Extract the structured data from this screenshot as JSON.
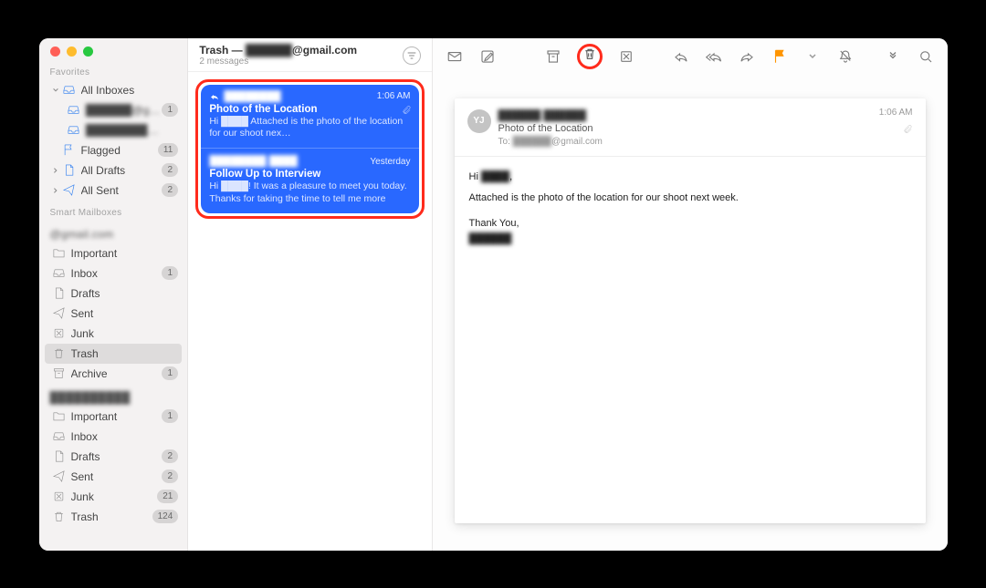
{
  "window": {
    "title_prefix": "Trash — ",
    "title_suffix": "@gmail.com",
    "subtitle": "2 messages"
  },
  "favorites_label": "Favorites",
  "favorites": [
    {
      "label": "All Inboxes",
      "count": null,
      "chevron": "down",
      "icon": "inbox"
    },
    {
      "label": "██████@g…",
      "count": "1",
      "indent": true,
      "icon": "inbox-sm",
      "blur": true
    },
    {
      "label": "████████…",
      "count": null,
      "indent": true,
      "icon": "inbox-sm",
      "blur": true
    },
    {
      "label": "Flagged",
      "count": "11",
      "icon": "flag"
    },
    {
      "label": "All Drafts",
      "count": "2",
      "chevron": "right",
      "icon": "doc"
    },
    {
      "label": "All Sent",
      "count": "2",
      "chevron": "right",
      "icon": "send"
    }
  ],
  "smart_label": "Smart Mailboxes",
  "account1": {
    "label": "@gmail.com",
    "items": [
      {
        "label": "Important",
        "icon": "folder"
      },
      {
        "label": "Inbox",
        "count": "1",
        "icon": "inbox-sm"
      },
      {
        "label": "Drafts",
        "icon": "doc"
      },
      {
        "label": "Sent",
        "icon": "send"
      },
      {
        "label": "Junk",
        "icon": "junk"
      },
      {
        "label": "Trash",
        "icon": "trash",
        "selected": true
      },
      {
        "label": "Archive",
        "count": "1",
        "icon": "archive"
      }
    ]
  },
  "account2": {
    "label": "██████████",
    "items": [
      {
        "label": "Important",
        "count": "1",
        "icon": "folder"
      },
      {
        "label": "Inbox",
        "icon": "inbox-sm"
      },
      {
        "label": "Drafts",
        "count": "2",
        "icon": "doc"
      },
      {
        "label": "Sent",
        "count": "2",
        "icon": "send"
      },
      {
        "label": "Junk",
        "count": "21",
        "icon": "junk"
      },
      {
        "label": "Trash",
        "count": "124",
        "icon": "trash"
      }
    ]
  },
  "messages": [
    {
      "sender": "████████",
      "time": "1:06 AM",
      "subject": "Photo of the Location",
      "preview": "Hi ████ Attached is the photo of the location for our shoot nex…",
      "has_attachment": true,
      "has_reply": true
    },
    {
      "sender": "████████ ████",
      "time": "Yesterday",
      "subject": "Follow Up to Interview",
      "preview": "Hi ████! It was a pleasure to meet you today. Thanks for taking the time to tell me more about the company and the position. I…",
      "has_attachment": false,
      "has_reply": false
    }
  ],
  "email": {
    "avatar": "YJ",
    "from": "██████ ██████",
    "subject": "Photo of the Location",
    "to": "To: ███████@gmail.com",
    "time": "1:06 AM",
    "body_line1": "Hi ████,",
    "body_line2": "Attached is the photo of the location for our shoot next week.",
    "body_line3": "Thank You,",
    "body_line4": "██████"
  }
}
